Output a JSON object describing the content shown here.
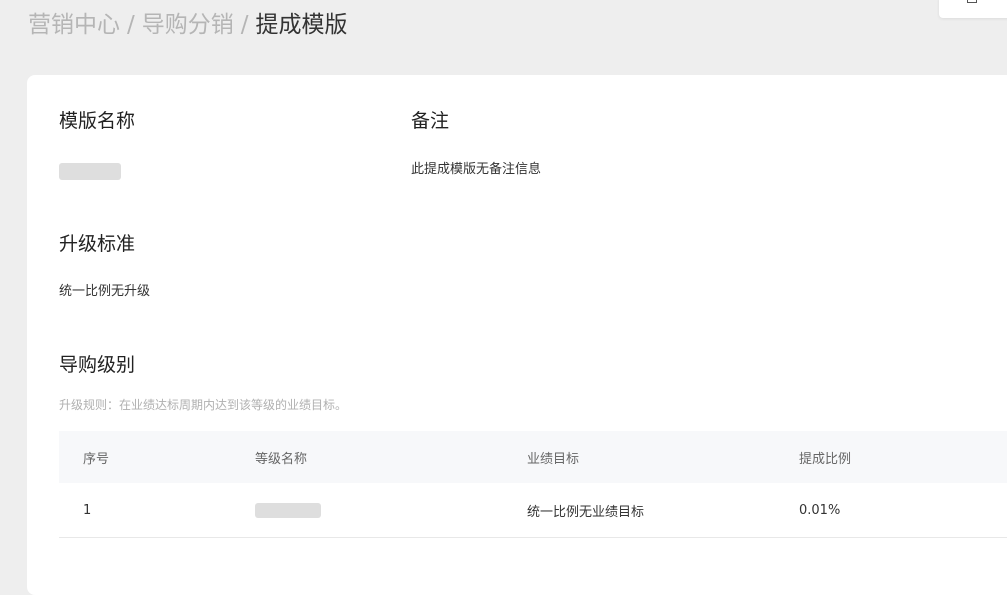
{
  "breadcrumb": {
    "items": [
      "营销中心",
      "导购分销"
    ],
    "separator": "/",
    "current": "提成模版"
  },
  "template_name": {
    "label": "模版名称"
  },
  "remark": {
    "label": "备注",
    "value": "此提成模版无备注信息"
  },
  "upgrade_standard": {
    "label": "升级标准",
    "value": "统一比例无升级"
  },
  "guide_levels": {
    "label": "导购级别",
    "hint": "升级规则：在业绩达标周期内达到该等级的业绩目标。",
    "columns": [
      "序号",
      "等级名称",
      "业绩目标",
      "提成比例"
    ],
    "rows": [
      {
        "index": "1",
        "target": "统一比例无业绩目标",
        "ratio": "0.01%"
      }
    ]
  }
}
